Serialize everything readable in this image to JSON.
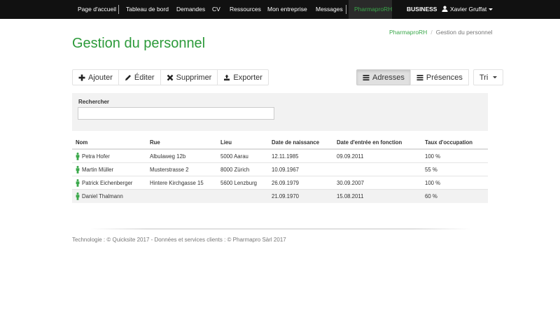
{
  "nav": {
    "items": [
      "Page d'accueil",
      "Tableau de bord",
      "Demandes",
      "CV",
      "Ressources",
      "Mon entreprise",
      "Messages"
    ],
    "app_name": "PharmaproRH",
    "business": "BUSINESS",
    "user": "Xavier Gruffat"
  },
  "breadcrumb": {
    "home": "PharmaproRH",
    "current": "Gestion du personnel"
  },
  "page_title": "Gestion du personnel",
  "toolbar": {
    "add": "Ajouter",
    "edit": "Éditer",
    "delete": "Supprimer",
    "export": "Exporter",
    "addresses": "Adresses",
    "presences": "Présences",
    "sort": "Tri"
  },
  "search": {
    "label": "Rechercher",
    "value": "",
    "placeholder": ""
  },
  "table": {
    "columns": [
      "Nom",
      "Rue",
      "Lieu",
      "Date de naissance",
      "Date d'entrée en fonction",
      "Taux d'occupation"
    ],
    "rows": [
      [
        "Petra Hofer",
        "Albulaweg 12b",
        "5000 Aarau",
        "12.11.1985",
        "09.09.2011",
        "100 %"
      ],
      [
        "Martin Müller",
        "Musterstrasse 2",
        "8000 Zürich",
        "10.09.1967",
        "",
        "55 %"
      ],
      [
        "Patrick Eichenberger",
        "Hintere Kirchgasse 15",
        "5600 Lenzburg",
        "26.09.1979",
        "30.09.2007",
        "100 %"
      ],
      [
        "Daniel Thalmann",
        "",
        "",
        "21.09.1970",
        "15.08.2011",
        "60 %"
      ]
    ]
  },
  "footer": "Technologie : © Quicksite 2017 - Données et services clients : © Pharmapro Sàrl 2017",
  "colors": {
    "brand_green": "#2c9a3a",
    "nav_bg": "#111111",
    "person_icon": "#3aa84a"
  }
}
